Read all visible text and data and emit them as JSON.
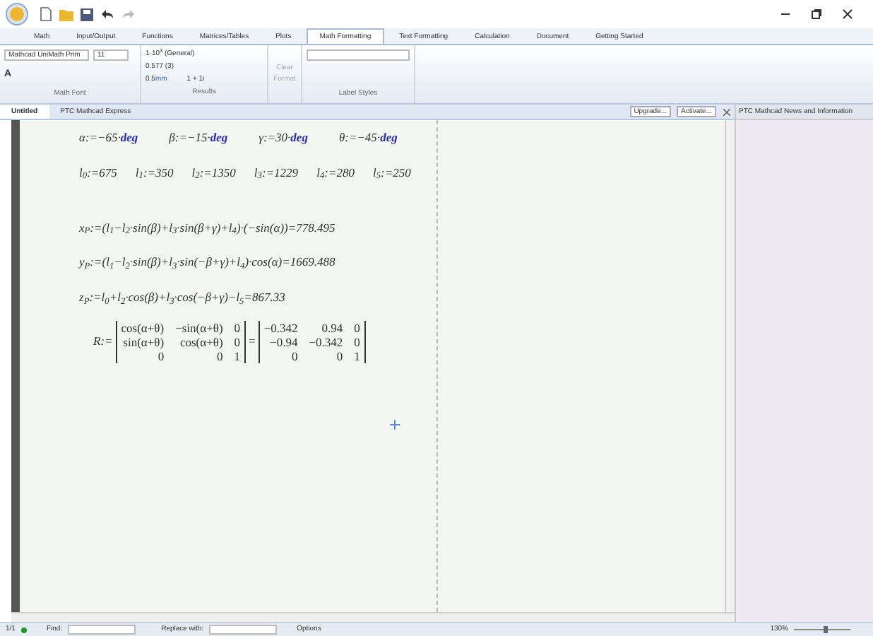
{
  "ribbon_tabs": [
    {
      "label": "Math",
      "selected": false
    },
    {
      "label": "Input/Output",
      "selected": false
    },
    {
      "label": "Functions",
      "selected": false
    },
    {
      "label": "Matrices/Tables",
      "selected": false
    },
    {
      "label": "Plots",
      "selected": false
    },
    {
      "label": "Math Formatting",
      "selected": true
    },
    {
      "label": "Text Formatting",
      "selected": false
    },
    {
      "label": "Calculation",
      "selected": false
    },
    {
      "label": "Document",
      "selected": false
    },
    {
      "label": "Getting Started",
      "selected": false
    }
  ],
  "ribbon": {
    "font": "Mathcad UniMath Prim",
    "size": "11",
    "font_color": "A",
    "font_group": "Math Font",
    "result_format": "1·10$^{3}$ (General)",
    "precision": "0.577 (3)",
    "unit": "0.5",
    "unit_suffix": "mm",
    "complex": "1 + 1i",
    "results_group": "Results",
    "clear_format": "Clear Format",
    "labels_group": "Label Styles"
  },
  "doc_tabs": [
    {
      "label": "Untitled",
      "selected": true
    },
    {
      "label": "PTC Mathcad Express",
      "selected": false
    }
  ],
  "doc_buttons": [
    "Upgrade...",
    "Activate..."
  ],
  "side_panel": {
    "title": "PTC Mathcad News and Information"
  },
  "worksheet": {
    "angles": [
      {
        "expr": "α:=−65·",
        "unit": "deg"
      },
      {
        "expr": "β:=−15·",
        "unit": "deg"
      },
      {
        "expr": "γ:=30·",
        "unit": "deg"
      },
      {
        "expr": "θ:=−45·",
        "unit": "deg"
      }
    ],
    "lengths": [
      "l$_{0}$:=675",
      "l$_{1}$:=350",
      "l$_{2}$:=1350",
      "l$_{3}$:=1229",
      "l$_{4}$:=280",
      "l$_{5}$:=250"
    ],
    "equations": [
      "x$_{P}$:=(l$_{1}$−l$_{2}$·sin(β)+l$_{3}$·sin(β+γ)+l$_{4}$)·(−sin(α))=778.495",
      "y$_{P}$:=(l$_{1}$−l$_{2}$·sin(β)+l$_{3}$·sin(−β+γ)+l$_{4}$)·cos(α)=1669.488",
      "z$_{P}$:=l$_{0}$+l$_{2}$·cos(β)+l$_{3}$·cos(−β+γ)−l$_{5}$=867.33"
    ],
    "matrix": {
      "name": "R:=",
      "symbolic": [
        [
          "cos(α+θ)",
          "−sin(α+θ)",
          "0"
        ],
        [
          "sin(α+θ)",
          "cos(α+θ)",
          "0"
        ],
        [
          "0",
          "0",
          "1"
        ]
      ],
      "equals": "=",
      "numeric": [
        [
          "−0.342",
          "0.94",
          "0"
        ],
        [
          "−0.94",
          "−0.342",
          "0"
        ],
        [
          "0",
          "0",
          "1"
        ]
      ]
    }
  },
  "status_bar": {
    "page": "1/1",
    "find_label": "Find:",
    "replace_label": "Replace with:",
    "options": "Options",
    "zoom": "130%",
    "zoom_slider": {
      "level": 0.6
    }
  }
}
